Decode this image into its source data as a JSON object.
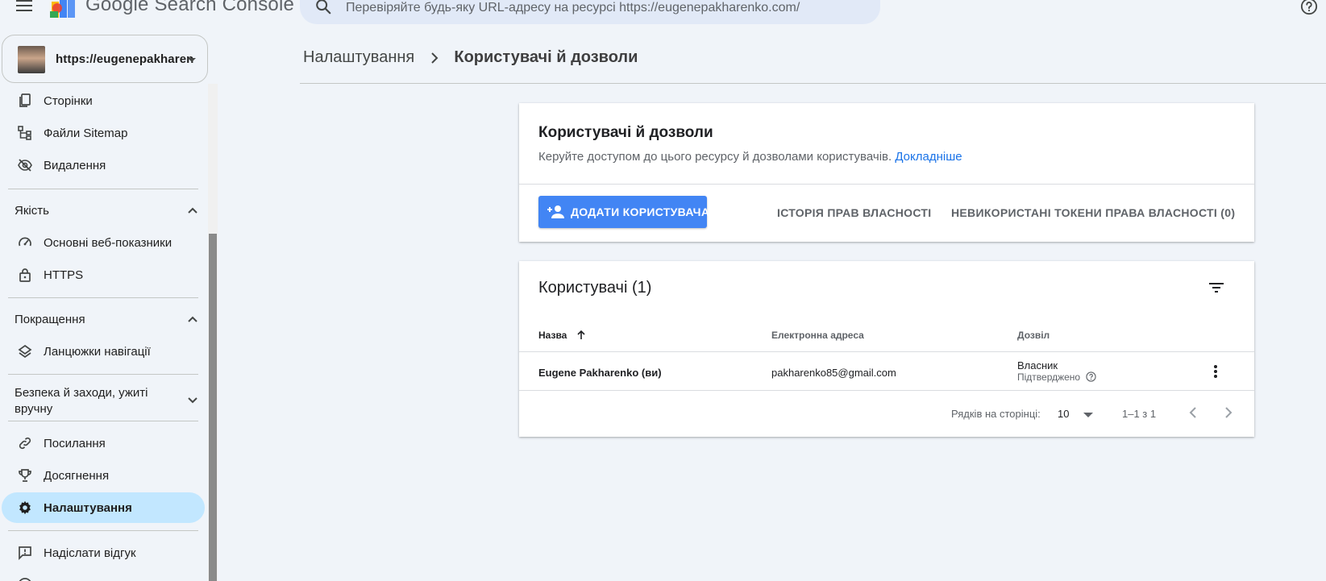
{
  "app": {
    "logo_text": "Google Search Console",
    "search_placeholder": "Перевіряйте будь-яку URL-адресу на ресурсі https://eugenepakharenko.com/"
  },
  "property": {
    "url": "https://eugenepakharen"
  },
  "sidebar": {
    "items_top": [
      {
        "label": "Сторінки",
        "icon": "pages-icon"
      },
      {
        "label": "Файли Sitemap",
        "icon": "sitemap-icon"
      },
      {
        "label": "Видалення",
        "icon": "visibility-off-icon"
      }
    ],
    "sections": {
      "quality": "Якість",
      "enhancements": "Покращення",
      "security": "Безпека й заходи, ужиті вручну"
    },
    "quality_items": [
      {
        "label": "Основні веб-показники",
        "icon": "speed-icon"
      },
      {
        "label": "HTTPS",
        "icon": "lock-icon"
      }
    ],
    "enhancement_items": [
      {
        "label": "Ланцюжки навігації",
        "icon": "layers-icon"
      }
    ],
    "items_bottom": [
      {
        "label": "Посилання",
        "icon": "link-icon"
      },
      {
        "label": "Досягнення",
        "icon": "trophy-icon"
      },
      {
        "label": "Налаштування",
        "icon": "gear-icon",
        "active": true
      }
    ],
    "footer_items": [
      {
        "label": "Надіслати відгук",
        "icon": "feedback-icon"
      }
    ]
  },
  "breadcrumb": {
    "parent": "Налаштування",
    "current": "Користувачі й дозволи"
  },
  "permissions_card": {
    "title": "Користувачі й дозволи",
    "description": "Керуйте доступом до цього ресурсу й дозволами користувачів.",
    "learn_more": "Докладніше",
    "add_user": "ДОДАТИ КОРИСТУВАЧА",
    "ownership_history": "ІСТОРІЯ ПРАВ ВЛАСНОСТІ",
    "unused_tokens": "НЕВИКОРИСТАНІ ТОКЕНИ ПРАВА ВЛАСНОСТІ (0)"
  },
  "users_card": {
    "title": "Користувачі (1)",
    "columns": {
      "name": "Назва",
      "email": "Електронна адреса",
      "permission": "Дозвіл"
    },
    "rows": [
      {
        "name": "Eugene Pakharenko (ви)",
        "email": "pakharenko85@gmail.com",
        "permission": "Власник",
        "status": "Підтверджено"
      }
    ],
    "pagination": {
      "rows_per_page_label": "Рядків на сторінці:",
      "rows_per_page": "10",
      "range": "1–1 з 1"
    }
  },
  "colors": {
    "background": "#f0f4f9",
    "accent": "#4285f4",
    "link": "#1a73e8",
    "active_nav": "#c2e7ff"
  }
}
